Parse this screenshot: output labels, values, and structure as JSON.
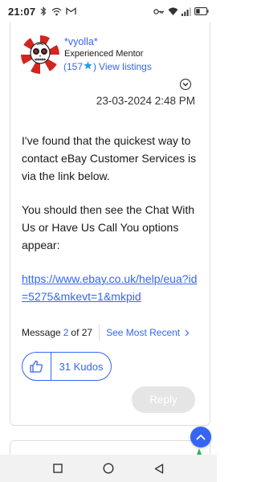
{
  "status_bar": {
    "time": "21:07",
    "left_icons": [
      "bluetooth-icon",
      "wifi-icon",
      "gmail-icon"
    ],
    "right_icons": [
      "vpn-key-icon",
      "wifi-icon",
      "cellular-signal-icon",
      "battery-icon"
    ]
  },
  "post": {
    "author": {
      "name": "*vyolla*",
      "role": "Experienced Mentor",
      "paren_open": "(",
      "feedback_score": "157",
      "paren_close": ")",
      "view_listings": "View listings"
    },
    "timestamp": "23-03-2024 2:48 PM",
    "paragraph1": "I've found that the quickest way to contact eBay Customer Services is via the link below.",
    "paragraph2": "You should then see the Chat With Us or Have Us Call You options appear:",
    "link": "https://www.ebay.co.uk/help/eua?id=5275&mkevt=1&mkpid"
  },
  "message_nav": {
    "prefix": "Message",
    "current": "2",
    "suffix": "of 27",
    "see_most_recent": "See Most Recent"
  },
  "kudos": {
    "label": "31 Kudos"
  },
  "reply_button": "Reply",
  "colors": {
    "accent": "#3665f3",
    "star": "#27a0e0",
    "reply_disabled_bg": "#e5e5e5",
    "border": "#dcdcdc"
  },
  "nav_bar": [
    "recents-icon",
    "home-icon",
    "back-icon"
  ]
}
